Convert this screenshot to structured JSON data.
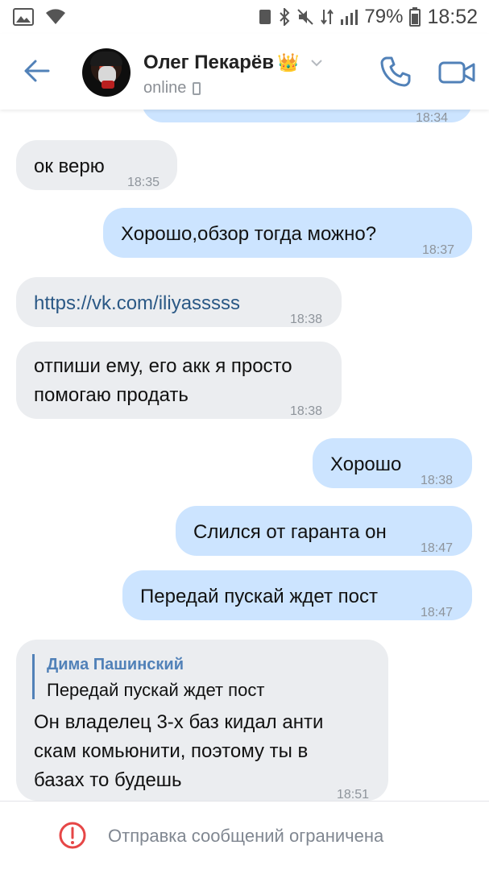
{
  "status_bar": {
    "battery_pct": "79%",
    "time": "18:52"
  },
  "header": {
    "contact_name": "Олег Пекарёв",
    "crown": "👑",
    "status": "online"
  },
  "messages": [
    {
      "dir": "out",
      "text": "",
      "time": "18:34"
    },
    {
      "dir": "in",
      "text": "ок верю",
      "time": "18:35"
    },
    {
      "dir": "out",
      "text": "Хорошо,обзор тогда можно?",
      "time": "18:37"
    },
    {
      "dir": "in",
      "text": "https://vk.com/iliyasssss",
      "time": "18:38"
    },
    {
      "dir": "in",
      "line1": "отпиши ему, его акк я просто",
      "line2": "помогаю продать",
      "time": "18:38"
    },
    {
      "dir": "out",
      "text": "Хорошо",
      "time": "18:38"
    },
    {
      "dir": "out",
      "text": "Слился от гаранта он",
      "time": "18:47"
    },
    {
      "dir": "out",
      "text": "Передай пускай ждет пост",
      "time": "18:47"
    },
    {
      "dir": "in",
      "reply_name": "Дима Пашинский",
      "reply_text": "Передай пускай ждет пост",
      "line1": "Он владелец 3-х баз кидал анти",
      "line2": "скам комьюнити, поэтому ты в",
      "line3": "базах то будешь",
      "time": "18:51"
    }
  ],
  "footer": {
    "notice": "Отправка сообщений ограничена"
  },
  "colors": {
    "accent": "#5181b8",
    "outgoing_bubble": "#cce4ff",
    "incoming_bubble": "#ebedf0",
    "warning": "#e64646"
  }
}
